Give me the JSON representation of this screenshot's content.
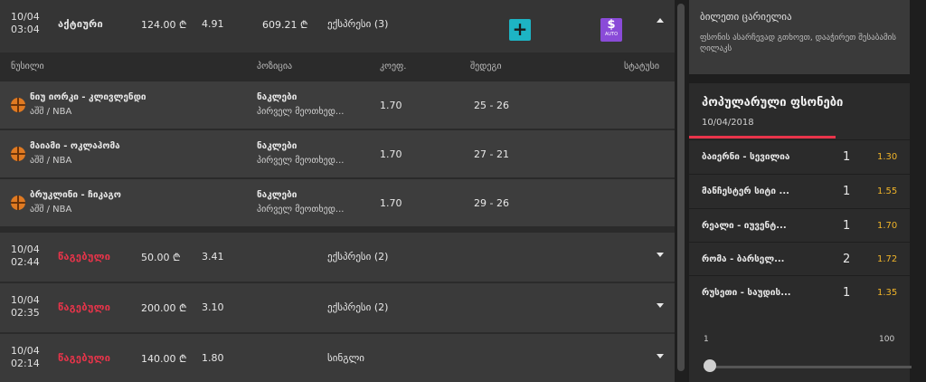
{
  "bets": [
    {
      "date": "10/04",
      "time": "03:04",
      "status": "აქტიური",
      "status_color": "#e8e8e8",
      "stake": "124.00 ₾",
      "odds": "4.91",
      "payout": "609.21 ₾",
      "type": "ექსპრესი (3)",
      "expanded": true
    },
    {
      "date": "10/04",
      "time": "02:44",
      "status": "წაგებული",
      "status_color": "#e8344a",
      "stake": "50.00 ₾",
      "odds": "3.41",
      "payout": "",
      "type": "ექსპრესი (2)",
      "expanded": false
    },
    {
      "date": "10/04",
      "time": "02:35",
      "status": "წაგებული",
      "status_color": "#e8344a",
      "stake": "200.00 ₾",
      "odds": "3.10",
      "payout": "",
      "type": "ექსპრესი (2)",
      "expanded": false
    },
    {
      "date": "10/04",
      "time": "02:14",
      "status": "წაგებული",
      "status_color": "#e8344a",
      "stake": "140.00 ₾",
      "odds": "1.80",
      "payout": "",
      "type": "სინგლი",
      "expanded": false
    }
  ],
  "auto_label": "AUTO",
  "add_label": "+",
  "detail_headers": {
    "event": "ნუსილი",
    "position": "პოზიცია",
    "odds": "კოეფ.",
    "score": "შედეგი",
    "status": "სტატუსი"
  },
  "selections": [
    {
      "event": "ნიუ იორკი - კლივლენდი",
      "league": "აშშ / NBA",
      "position": "ნაკლები",
      "market": "პირველ მეოთხედ...",
      "odds": "1.70",
      "score": "25 - 26",
      "icon": "basketball-icon"
    },
    {
      "event": "მაიამი - ოკლაჰომა",
      "league": "აშშ / NBA",
      "position": "ნაკლები",
      "market": "პირველ მეოთხედ...",
      "odds": "1.70",
      "score": "27 - 21",
      "icon": "basketball-icon"
    },
    {
      "event": "ბრუკლინი - ჩიკაგო",
      "league": "აშშ / NBA",
      "position": "ნაკლები",
      "market": "პირველ მეოთხედ...",
      "odds": "1.70",
      "score": "29 - 26",
      "icon": "basketball-icon"
    }
  ],
  "betslip": {
    "title": "ბილეთი ცარიელია",
    "message": "ფსონის ასარჩევად გთხოვთ, დააჭირეთ შესაბამის ღილაკს"
  },
  "popular": {
    "title": "პოპულარული ფსონები",
    "date": "10/04/2018",
    "items": [
      {
        "name": "ბაიერნი - სევილია",
        "pick": "1",
        "odds": "1.30"
      },
      {
        "name": "მანჩესტერ სიტი ...",
        "pick": "1",
        "odds": "1.55"
      },
      {
        "name": "რეალი - იუვენტ...",
        "pick": "1",
        "odds": "1.70"
      },
      {
        "name": "რომა - ბარსელ...",
        "pick": "2",
        "odds": "1.72"
      },
      {
        "name": "რუსეთი - საუდის...",
        "pick": "1",
        "odds": "1.35"
      }
    ]
  },
  "slider": {
    "min": "1",
    "max": "100",
    "value": 1
  },
  "colors": {
    "accent": "#e8344a",
    "odds_highlight": "#f0b429",
    "add_button": "#1db4c4",
    "auto_button": "#8a4bd8"
  }
}
